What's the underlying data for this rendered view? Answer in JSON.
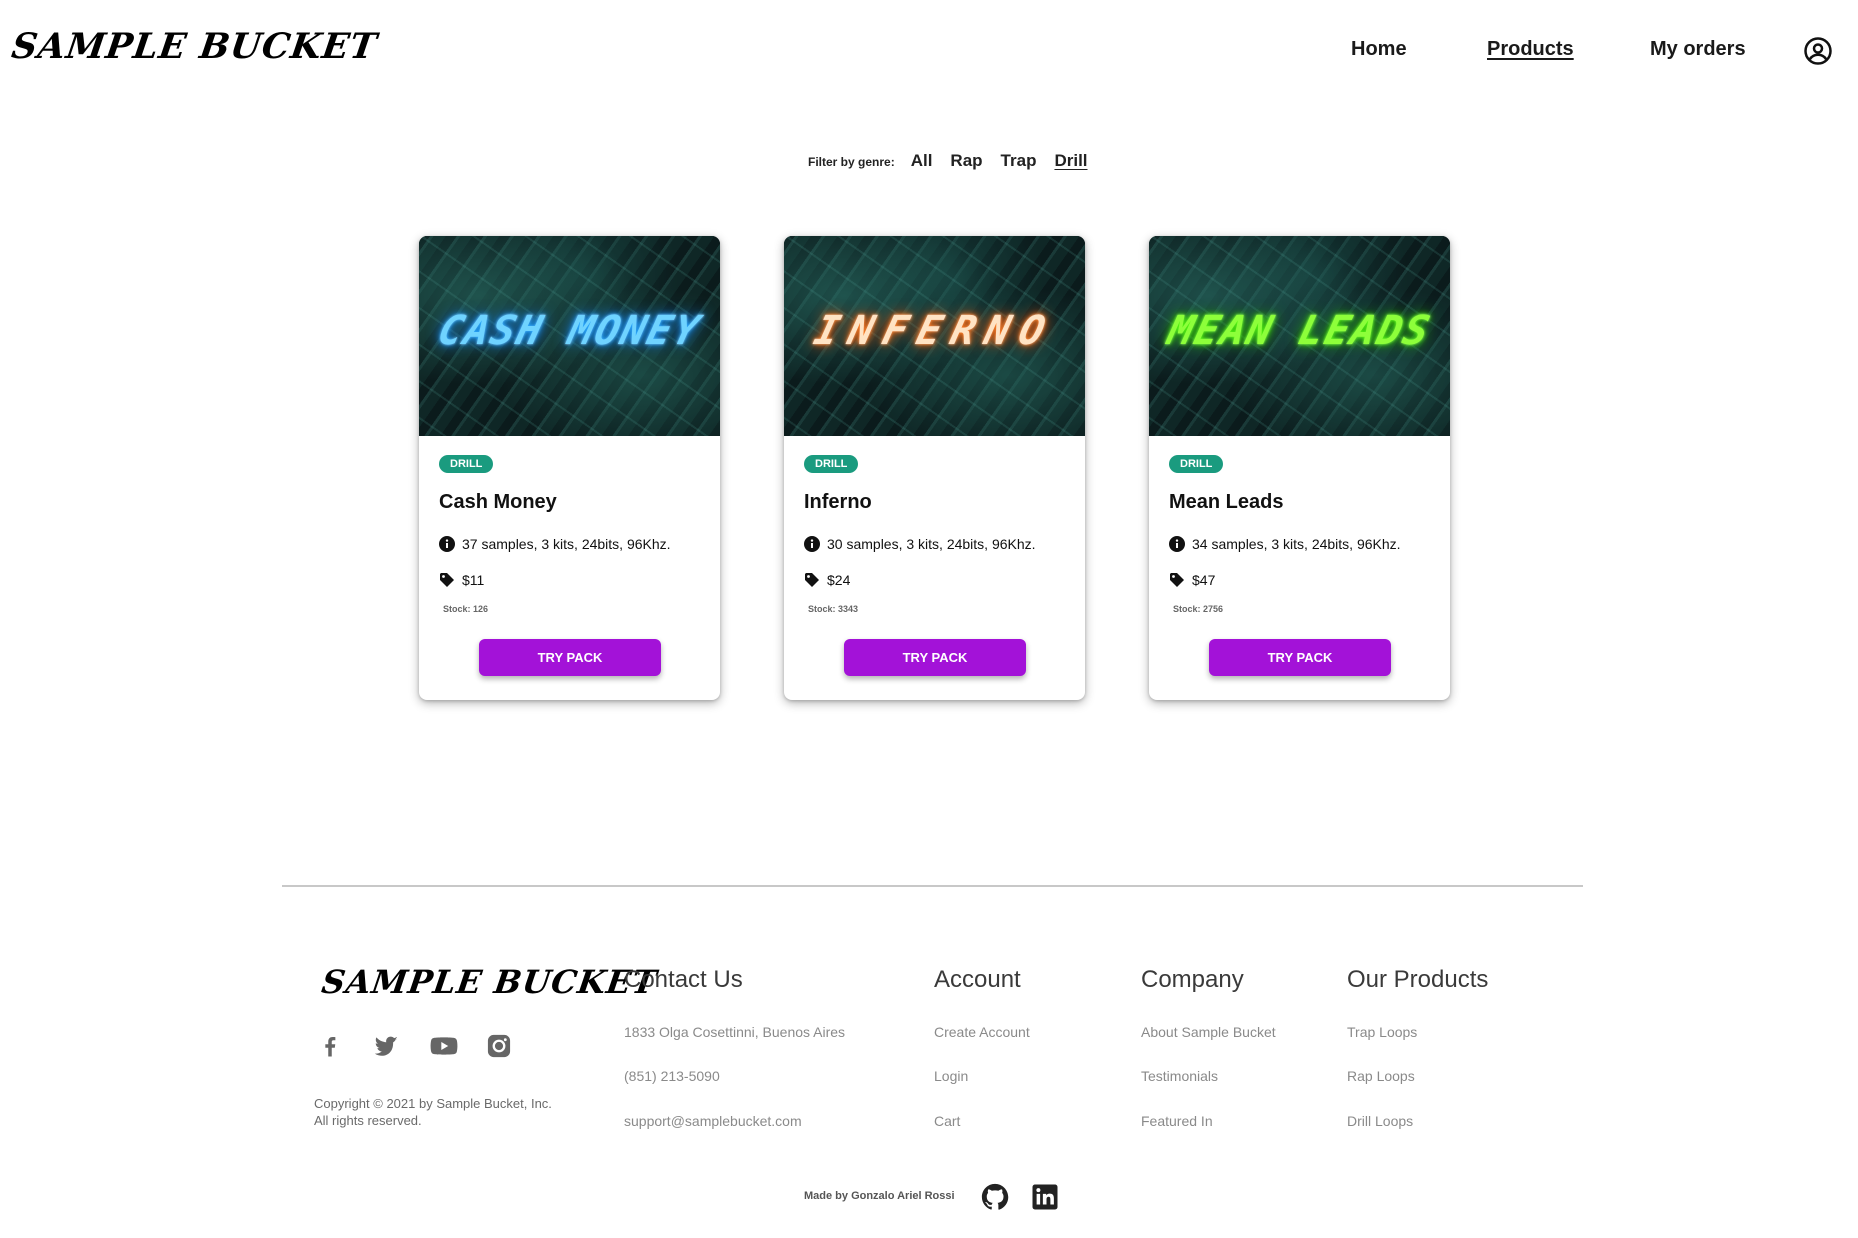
{
  "header": {
    "logo": "SAMPLE BUCKET",
    "nav": [
      "Home",
      "Products",
      "My orders"
    ],
    "active_nav": "Products",
    "user_icon": "user-circle-icon"
  },
  "filter": {
    "label": "Filter by genre:",
    "options": [
      "All",
      "Rap",
      "Trap",
      "Drill"
    ],
    "active": "Drill"
  },
  "products": [
    {
      "cover_text": "CASH MONEY",
      "cover_color": "#6fd3ff",
      "genre": "DRILL",
      "title": "Cash Money",
      "details": "37 samples, 3 kits, 24bits, 96Khz.",
      "price": "$11",
      "stock": "Stock: 126",
      "button": "TRY PACK"
    },
    {
      "cover_text": "INFERNO",
      "cover_color": "#ffe3c4",
      "genre": "DRILL",
      "title": "Inferno",
      "details": "30 samples, 3 kits, 24bits, 96Khz.",
      "price": "$24",
      "stock": "Stock: 3343",
      "button": "TRY PACK"
    },
    {
      "cover_text": "MEAN LEADS",
      "cover_color": "#8dff3a",
      "genre": "DRILL",
      "title": "Mean Leads",
      "details": "34 samples, 3 kits, 24bits, 96Khz.",
      "price": "$47",
      "stock": "Stock: 2756",
      "button": "TRY PACK"
    }
  ],
  "footer": {
    "logo": "SAMPLE BUCKET",
    "social_icons": [
      "facebook-icon",
      "twitter-icon",
      "youtube-icon",
      "instagram-icon"
    ],
    "copyright": "Copyright © 2021 by Sample Bucket, Inc. All rights reserved.",
    "contact": {
      "heading": "Contact Us",
      "address": "1833 Olga Cosettinni, Buenos Aires",
      "phone": "(851) 213-5090",
      "email": "support@samplebucket.com"
    },
    "account": {
      "heading": "Account",
      "links": [
        "Create Account",
        "Login",
        "Cart"
      ]
    },
    "company": {
      "heading": "Company",
      "links": [
        "About Sample Bucket",
        "Testimonials",
        "Featured In"
      ]
    },
    "our_products": {
      "heading": "Our Products",
      "links": [
        "Trap Loops",
        "Rap Loops",
        "Drill Loops"
      ]
    },
    "made_by": "Made by Gonzalo Ariel Rossi",
    "dev_icons": [
      "github-icon",
      "linkedin-icon"
    ]
  },
  "colors": {
    "badge": "#1a9b7f",
    "button": "#a312d8"
  }
}
